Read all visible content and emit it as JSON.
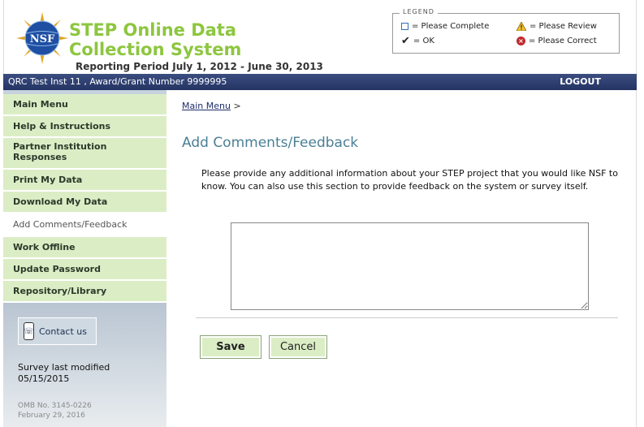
{
  "header": {
    "title": "STEP Online Data Collection System",
    "reporting_period": "Reporting Period July 1, 2012 - June 30, 2013",
    "logo_text": "NSF"
  },
  "legend": {
    "title": "LEGEND",
    "please_complete": "= Please Complete",
    "ok": "= OK",
    "please_review": "= Please Review",
    "please_correct": "= Please Correct",
    "icons": [
      "checkbox-icon",
      "checkmark-icon",
      "warning-icon",
      "error-icon"
    ]
  },
  "navbar": {
    "institution": "QRC Test Inst 11 , Award/Grant Number 9999995",
    "logout": "LOGOUT"
  },
  "sidebar": {
    "items": [
      {
        "label": "Main Menu"
      },
      {
        "label": "Help & Instructions"
      },
      {
        "label": "Partner Institution Responses"
      },
      {
        "label": "Print My Data"
      },
      {
        "label": "Download My Data"
      },
      {
        "label": "Add Comments/Feedback"
      },
      {
        "label": "Work Offline"
      },
      {
        "label": "Update Password"
      },
      {
        "label": "Repository/Library"
      }
    ],
    "contact": "Contact us",
    "survey_modified_label": "Survey last modified",
    "survey_modified_date": "05/15/2015",
    "omb_number": "OMB No. 3145-0226",
    "omb_date": "February 29, 2016"
  },
  "main": {
    "breadcrumb_link": "Main Menu",
    "breadcrumb_sep": ">",
    "title": "Add Comments/Feedback",
    "instructions": "Please provide any additional information about your STEP project that you would like NSF to know. You can also use this section to provide feedback on the system or survey itself.",
    "comments_value": "",
    "save_label": "Save",
    "cancel_label": "Cancel"
  },
  "colors": {
    "title_green": "#8dc63f",
    "navbar_blue": "#2d3d6e",
    "menu_green": "#dbedc5",
    "heading_teal": "#4a7f95"
  }
}
